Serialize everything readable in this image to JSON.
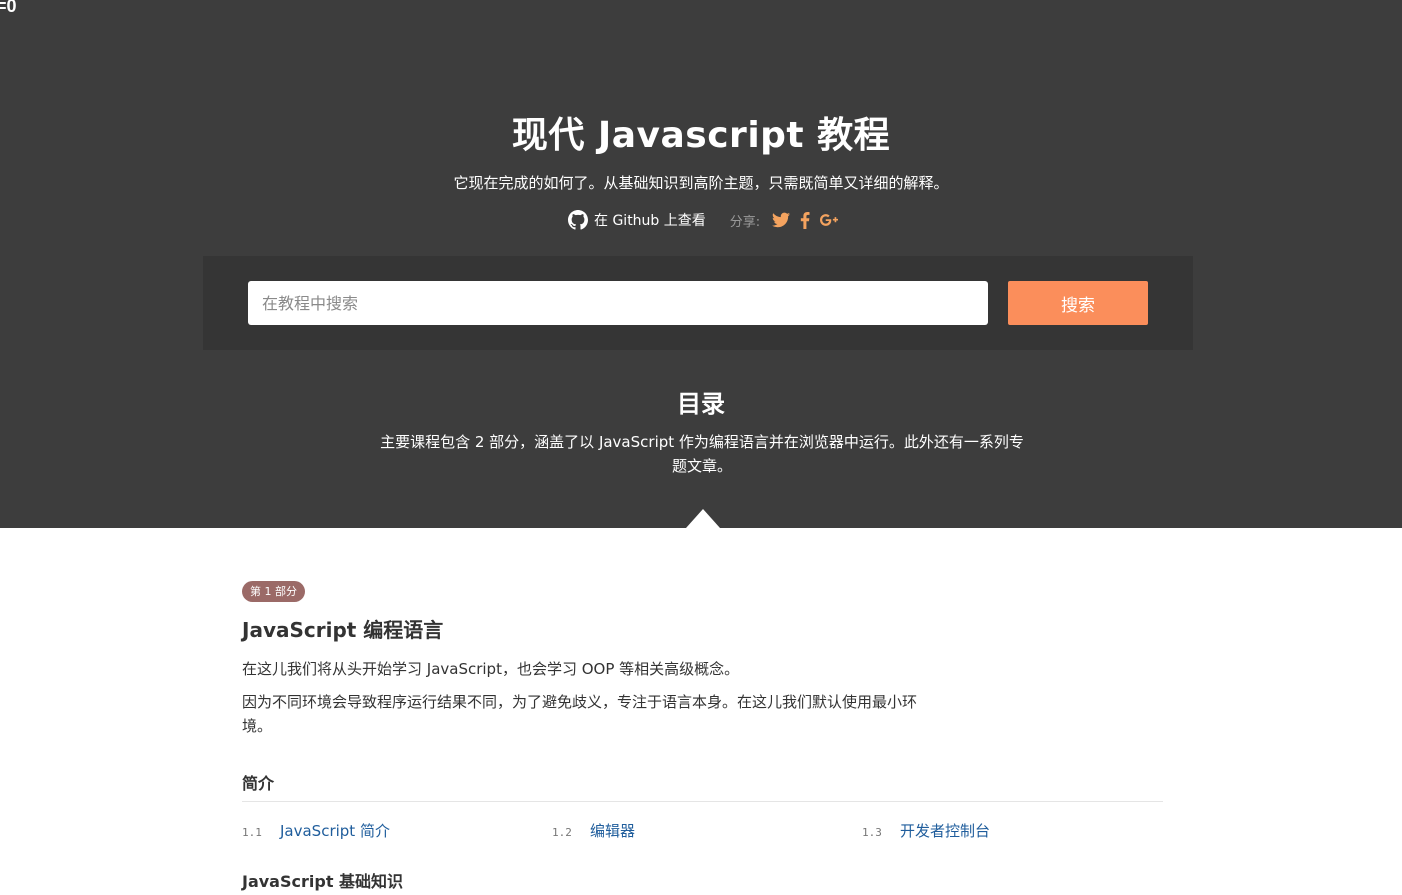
{
  "corner_label": "=0",
  "hero": {
    "title": "现代 Javascript 教程",
    "subtitle": "它现在完成的如何了。从基础知识到高阶主题，只需既简单又详细的解释。",
    "github_link": "在 Github 上查看",
    "share_label": "分享:",
    "share_icons": [
      "twitter-icon",
      "facebook-icon",
      "google-plus-icon"
    ],
    "accent_color": "#f4a35f"
  },
  "search": {
    "placeholder": "在教程中搜索",
    "value": "",
    "button_label": "搜索",
    "button_color": "#fb8e5b"
  },
  "toc": {
    "heading": "目录",
    "description": "主要课程包含 2 部分，涵盖了以 JavaScript 作为编程语言并在浏览器中运行。此外还有一系列专题文章。"
  },
  "part1": {
    "badge": "第 1 部分",
    "badge_color": "#9b6a67",
    "title": "JavaScript 编程语言",
    "paragraph1": "在这儿我们将从头开始学习 JavaScript，也会学习 OOP 等相关高级概念。",
    "paragraph2": "因为不同环境会导致程序运行结果不同，为了避免歧义，专注于语言本身。在这儿我们默认使用最小环境。",
    "sections": [
      {
        "heading": "简介",
        "lessons": [
          {
            "num": "1.1",
            "label": "JavaScript 简介"
          },
          {
            "num": "1.2",
            "label": "编辑器"
          },
          {
            "num": "1.3",
            "label": "开发者控制台"
          }
        ]
      },
      {
        "heading": "JavaScript 基础知识",
        "lessons": []
      }
    ]
  }
}
